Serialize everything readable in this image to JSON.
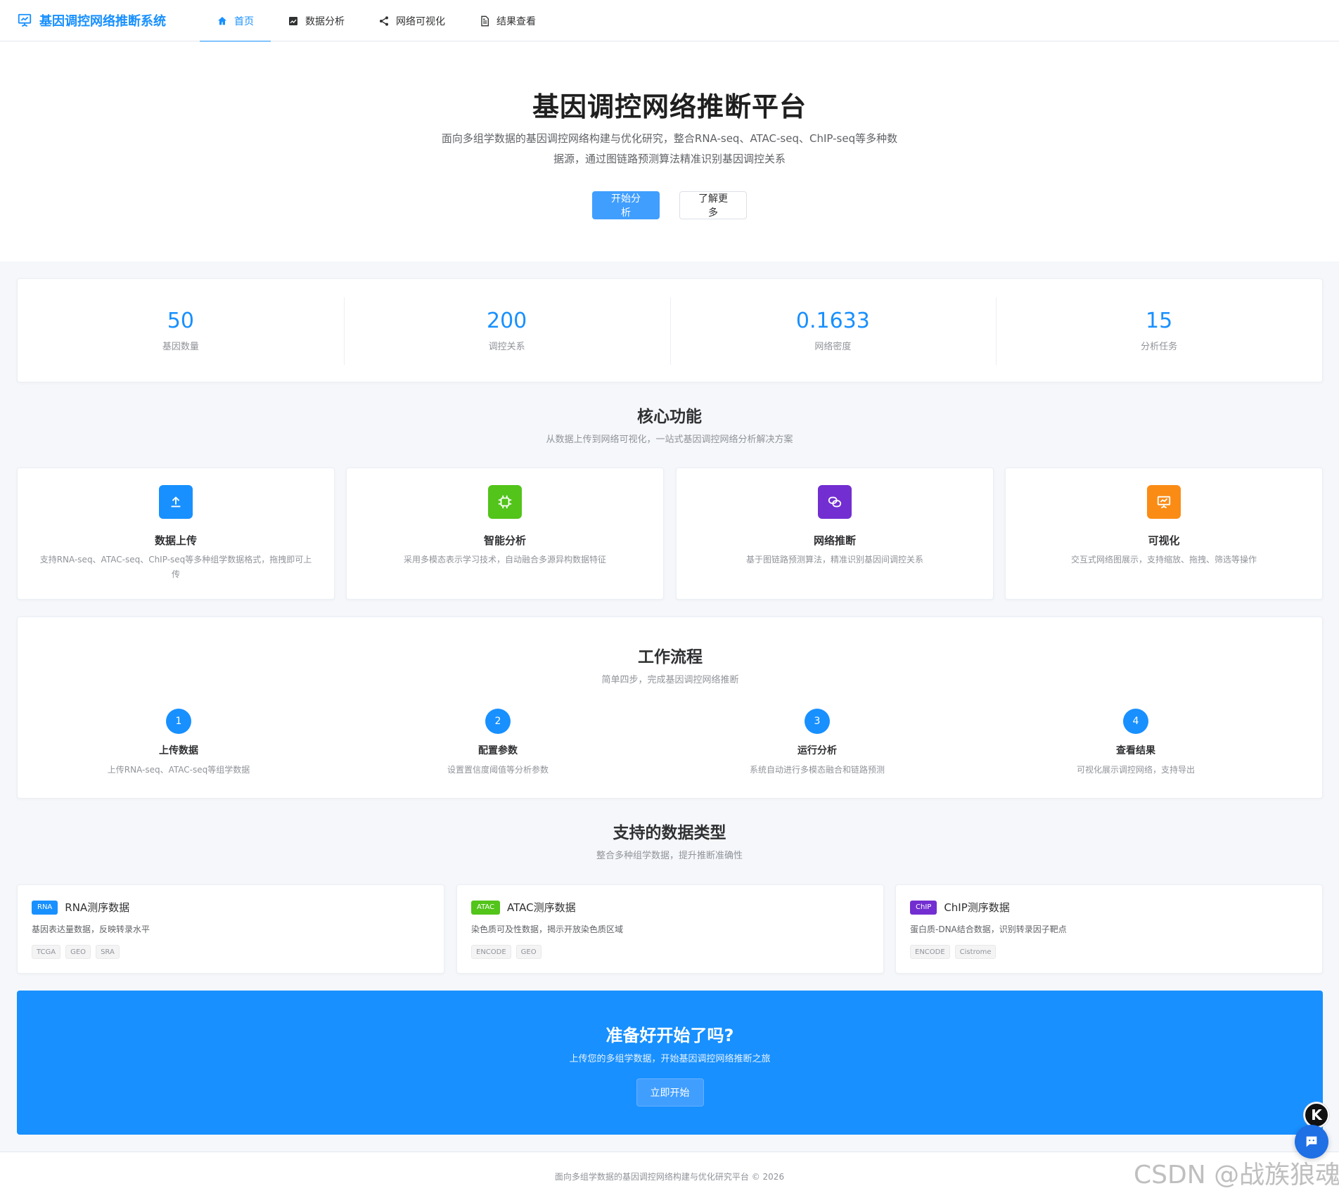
{
  "brand": {
    "title": "基因调控网络推断系统"
  },
  "nav": {
    "items": [
      {
        "label": "首页",
        "icon": "home-icon",
        "active": true
      },
      {
        "label": "数据分析",
        "icon": "chart-icon",
        "active": false
      },
      {
        "label": "网络可视化",
        "icon": "share-icon",
        "active": false
      },
      {
        "label": "结果查看",
        "icon": "document-icon",
        "active": false
      }
    ]
  },
  "hero": {
    "title": "基因调控网络推断平台",
    "description": "面向多组学数据的基因调控网络构建与优化研究，整合RNA-seq、ATAC-seq、ChIP-seq等多种数据源，通过图链路预测算法精准识别基因调控关系",
    "primary_button": "开始分析",
    "secondary_button": "了解更多"
  },
  "stats": [
    {
      "value": "50",
      "label": "基因数量"
    },
    {
      "value": "200",
      "label": "调控关系"
    },
    {
      "value": "0.1633",
      "label": "网络密度"
    },
    {
      "value": "15",
      "label": "分析任务"
    }
  ],
  "features_section": {
    "title": "核心功能",
    "subtitle": "从数据上传到网络可视化，一站式基因调控网络分析解决方案",
    "items": [
      {
        "title": "数据上传",
        "desc": "支持RNA-seq、ATAC-seq、ChIP-seq等多种组学数据格式，拖拽即可上传",
        "icon": "upload-icon",
        "color": "#1890ff"
      },
      {
        "title": "智能分析",
        "desc": "采用多模态表示学习技术，自动融合多源异构数据特征",
        "icon": "cpu-icon",
        "color": "#52c41a"
      },
      {
        "title": "网络推断",
        "desc": "基于图链路预测算法，精准识别基因间调控关系",
        "icon": "link-icon",
        "color": "#722ed1"
      },
      {
        "title": "可视化",
        "desc": "交互式网络图展示，支持缩放、拖拽、筛选等操作",
        "icon": "presentation-icon",
        "color": "#fa8c16"
      }
    ]
  },
  "workflow": {
    "title": "工作流程",
    "subtitle": "简单四步，完成基因调控网络推断",
    "steps": [
      {
        "num": "1",
        "title": "上传数据",
        "desc": "上传RNA-seq、ATAC-seq等组学数据"
      },
      {
        "num": "2",
        "title": "配置参数",
        "desc": "设置置信度阈值等分析参数"
      },
      {
        "num": "3",
        "title": "运行分析",
        "desc": "系统自动进行多模态融合和链路预测"
      },
      {
        "num": "4",
        "title": "查看结果",
        "desc": "可视化展示调控网络，支持导出"
      }
    ]
  },
  "data_types": {
    "title": "支持的数据类型",
    "subtitle": "整合多种组学数据，提升推断准确性",
    "items": [
      {
        "tag": "RNA",
        "tag_color": "#1890ff",
        "title": "RNA测序数据",
        "desc": "基因表达量数据，反映转录水平",
        "sources": [
          "TCGA",
          "GEO",
          "SRA"
        ]
      },
      {
        "tag": "ATAC",
        "tag_color": "#52c41a",
        "title": "ATAC测序数据",
        "desc": "染色质可及性数据，揭示开放染色质区域",
        "sources": [
          "ENCODE",
          "GEO"
        ]
      },
      {
        "tag": "ChIP",
        "tag_color": "#722ed1",
        "title": "ChIP测序数据",
        "desc": "蛋白质-DNA结合数据，识别转录因子靶点",
        "sources": [
          "ENCODE",
          "Cistrome"
        ]
      }
    ]
  },
  "cta": {
    "title": "准备好开始了吗?",
    "subtitle": "上传您的多组学数据，开始基因调控网络推断之旅",
    "button": "立即开始"
  },
  "footer": {
    "text": "面向多组学数据的基因调控网络构建与优化研究平台 © 2026"
  },
  "floating": {
    "k_label": "K"
  },
  "watermark": "CSDN @战族狼魂"
}
